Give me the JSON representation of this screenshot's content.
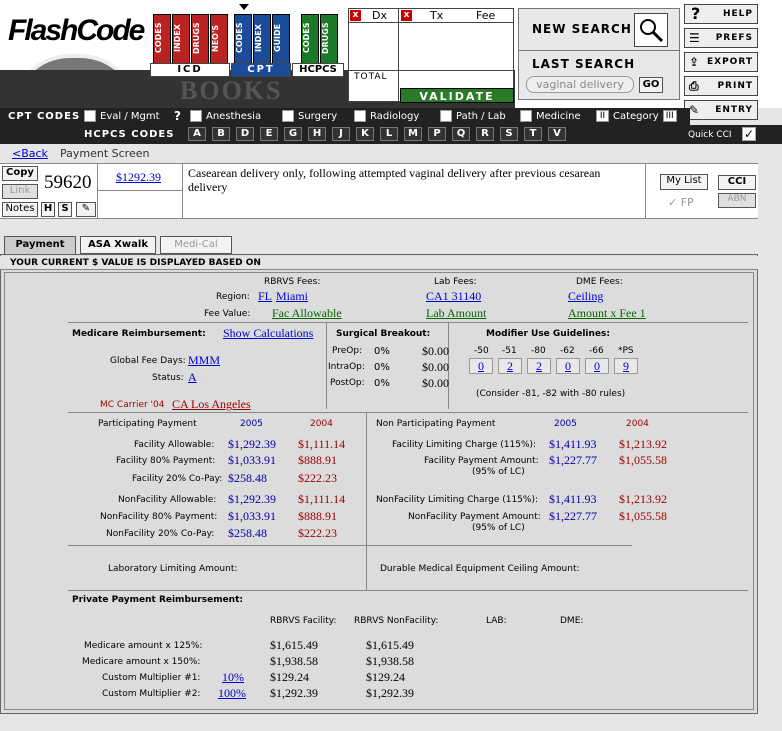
{
  "header": {
    "logo_text": "FlashCode",
    "books_word": "BOOKS",
    "book_groups": [
      {
        "label": "ICD",
        "books": [
          "CODES",
          "INDEX",
          "DRUGS",
          "NEO'S"
        ]
      },
      {
        "label": "CPT",
        "books": [
          "CODES",
          "INDEX",
          "GUIDE"
        ]
      },
      {
        "label": "HCPCS",
        "books": [
          "CODES",
          "DRUGS"
        ]
      }
    ],
    "dx_label": "Dx",
    "tx_label": "Tx",
    "fee_label": "Fee",
    "total_label": "TOTAL",
    "validate_label": "VALIDATE",
    "new_search_label": "NEW SEARCH",
    "last_search_label": "LAST SEARCH",
    "last_search_value": "vaginal delivery",
    "go_label": "GO",
    "side_buttons": [
      "HELP",
      "PREFS",
      "EXPORT",
      "PRINT",
      "ENTRY"
    ]
  },
  "cpt_nav": {
    "title": "CPT CODES",
    "items": [
      "Eval / Mgmt",
      "?",
      "Anesthesia",
      "Surgery",
      "Radiology",
      "Path / Lab",
      "Medicine",
      "Category"
    ],
    "category_suffix": "III"
  },
  "hcpcs_nav": {
    "title": "HCPCS CODES",
    "letters": [
      "A",
      "B",
      "D",
      "E",
      "G",
      "H",
      "J",
      "K",
      "L",
      "M",
      "P",
      "Q",
      "R",
      "S",
      "T",
      "V"
    ],
    "quick_cci": "Quick CCI"
  },
  "breadcrumb": {
    "back": "<Back",
    "screen": "Payment Screen"
  },
  "code_row": {
    "copy": "Copy",
    "link": "Link",
    "notes": "Notes",
    "h": "H",
    "s": "S",
    "code": "59620",
    "fee": "$1292.39",
    "description": "Casearean delivery only, following attempted vaginal delivery after previous cesarean delivery",
    "my_list": "My List",
    "fp": "FP",
    "cci": "CCI",
    "abn": "ABN"
  },
  "tabs": [
    "Payment",
    "ASA Xwalk",
    "Medi-Cal"
  ],
  "banner": "YOUR CURRENT $ VALUE IS DISPLAYED BASED ON",
  "fees": {
    "rbrvs_label": "RBRVS Fees:",
    "lab_label": "Lab Fees:",
    "dme_label": "DME Fees:",
    "region_label": "Region:",
    "region_fl": "FL",
    "region_city": "Miami",
    "lab_region": "CA1 31140",
    "dme_region": "Ceiling",
    "fee_value_label": "Fee Value:",
    "fee_value": "Fac Allowable",
    "lab_value": "Lab Amount",
    "dme_value": "Amount x Fee 1"
  },
  "medicare": {
    "title": "Medicare Reimbursement:",
    "show_calc": "Show Calculations",
    "global_label": "Global Fee Days:",
    "global_value": "MMM",
    "status_label": "Status:",
    "status_value": "A",
    "carrier_label": "MC Carrier '04",
    "carrier_value": "CA Los Angeles"
  },
  "surgical": {
    "title": "Surgical Breakout:",
    "rows": [
      {
        "label": "PreOp:",
        "pct": "0%",
        "amt": "$0.00"
      },
      {
        "label": "IntraOp:",
        "pct": "0%",
        "amt": "$0.00"
      },
      {
        "label": "PostOp:",
        "pct": "0%",
        "amt": "$0.00"
      }
    ]
  },
  "modifier": {
    "title": "Modifier Use Guidelines:",
    "headers": [
      "-50",
      "-51",
      "-80",
      "-62",
      "-66",
      "*PS"
    ],
    "values": [
      "0",
      "2",
      "2",
      "0",
      "0",
      "9"
    ],
    "note": "(Consider -81, -82 with -80 rules)"
  },
  "participating": {
    "title": "Participating Payment",
    "y1": "2005",
    "y2": "2004",
    "rows": [
      {
        "label": "Facility Allowable:",
        "v1": "$1,292.39",
        "v2": "$1,111.14"
      },
      {
        "label": "Facility 80% Payment:",
        "v1": "$1,033.91",
        "v2": "$888.91"
      },
      {
        "label": "Facility 20% Co-Pay:",
        "v1": "$258.48",
        "v2": "$222.23"
      },
      {
        "label": "NonFacility Allowable:",
        "v1": "$1,292.39",
        "v2": "$1,111.14"
      },
      {
        "label": "NonFacility 80% Payment:",
        "v1": "$1,033.91",
        "v2": "$888.91"
      },
      {
        "label": "NonFacility 20% Co-Pay:",
        "v1": "$258.48",
        "v2": "$222.23"
      }
    ]
  },
  "nonparticipating": {
    "title": "Non Participating Payment",
    "y1": "2005",
    "y2": "2004",
    "rows": [
      {
        "label": "Facility Limiting Charge (115%):",
        "v1": "$1,411.93",
        "v2": "$1,213.92"
      },
      {
        "label": "Facility Payment Amount:",
        "v1": "$1,227.77",
        "v2": "$1,055.58",
        "sub": "(95% of LC)"
      },
      {
        "label": "NonFacility Limiting Charge (115%):",
        "v1": "$1,411.93",
        "v2": "$1,213.92"
      },
      {
        "label": "NonFacility Payment Amount:",
        "v1": "$1,227.77",
        "v2": "$1,055.58",
        "sub": "(95% of LC)"
      }
    ]
  },
  "lab_limit_label": "Laboratory Limiting Amount:",
  "dme_ceiling_label": "Durable Medical Equipment Ceiling Amount:",
  "private": {
    "title": "Private Payment Reimbursement:",
    "col_fac": "RBRVS Facility:",
    "col_nonfac": "RBRVS NonFacility:",
    "col_lab": "LAB:",
    "col_dme": "DME:",
    "rows": [
      {
        "label": "Medicare amount x 125%:",
        "mult": "",
        "fac": "$1,615.49",
        "nonfac": "$1,615.49"
      },
      {
        "label": "Medicare amount x 150%:",
        "mult": "",
        "fac": "$1,938.58",
        "nonfac": "$1,938.58"
      },
      {
        "label": "Custom Multiplier #1:",
        "mult": "10%",
        "fac": "$129.24",
        "nonfac": "$129.24"
      },
      {
        "label": "Custom Multiplier #2:",
        "mult": "100%",
        "fac": "$1,292.39",
        "nonfac": "$1,292.39"
      }
    ]
  }
}
